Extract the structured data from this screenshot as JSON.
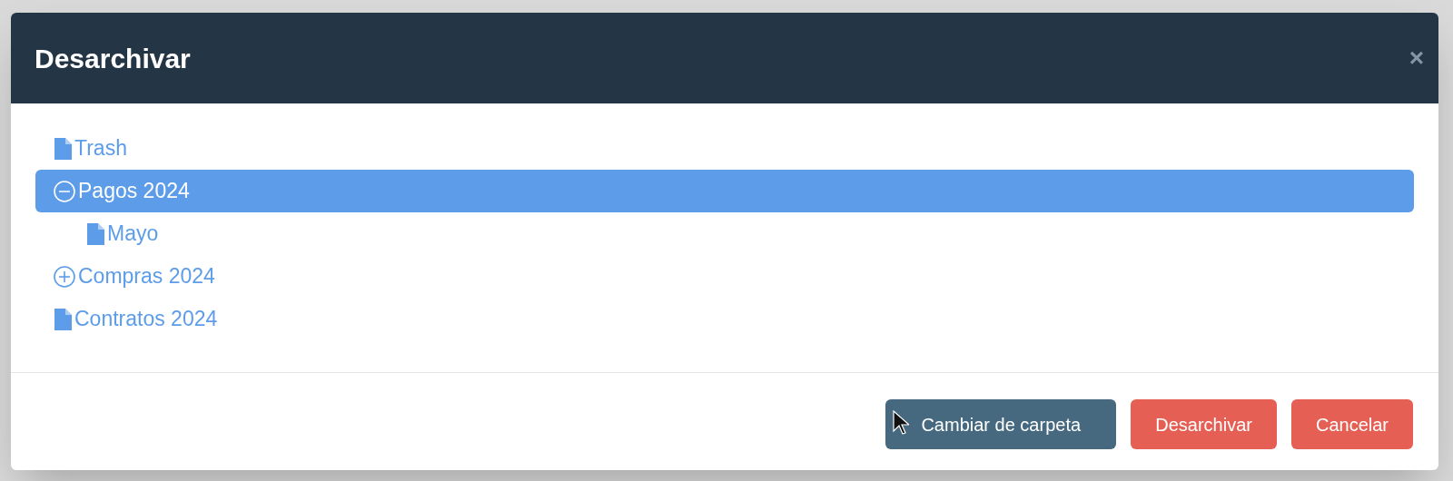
{
  "dialog": {
    "title": "Desarchivar",
    "close": "×"
  },
  "tree": [
    {
      "label": "Trash",
      "kind": "leaf",
      "selected": false
    },
    {
      "label": "Pagos 2024",
      "kind": "folder",
      "expanded": true,
      "selected": true,
      "children": [
        {
          "label": "Mayo",
          "kind": "leaf",
          "selected": false
        }
      ]
    },
    {
      "label": "Compras 2024",
      "kind": "folder",
      "expanded": false,
      "selected": false
    },
    {
      "label": "Contratos 2024",
      "kind": "leaf",
      "selected": false
    }
  ],
  "buttons": [
    {
      "label": "Cambiar de carpeta",
      "kind": "secondary"
    },
    {
      "label": "Desarchivar",
      "kind": "danger"
    },
    {
      "label": "Cancelar",
      "kind": "danger"
    }
  ]
}
